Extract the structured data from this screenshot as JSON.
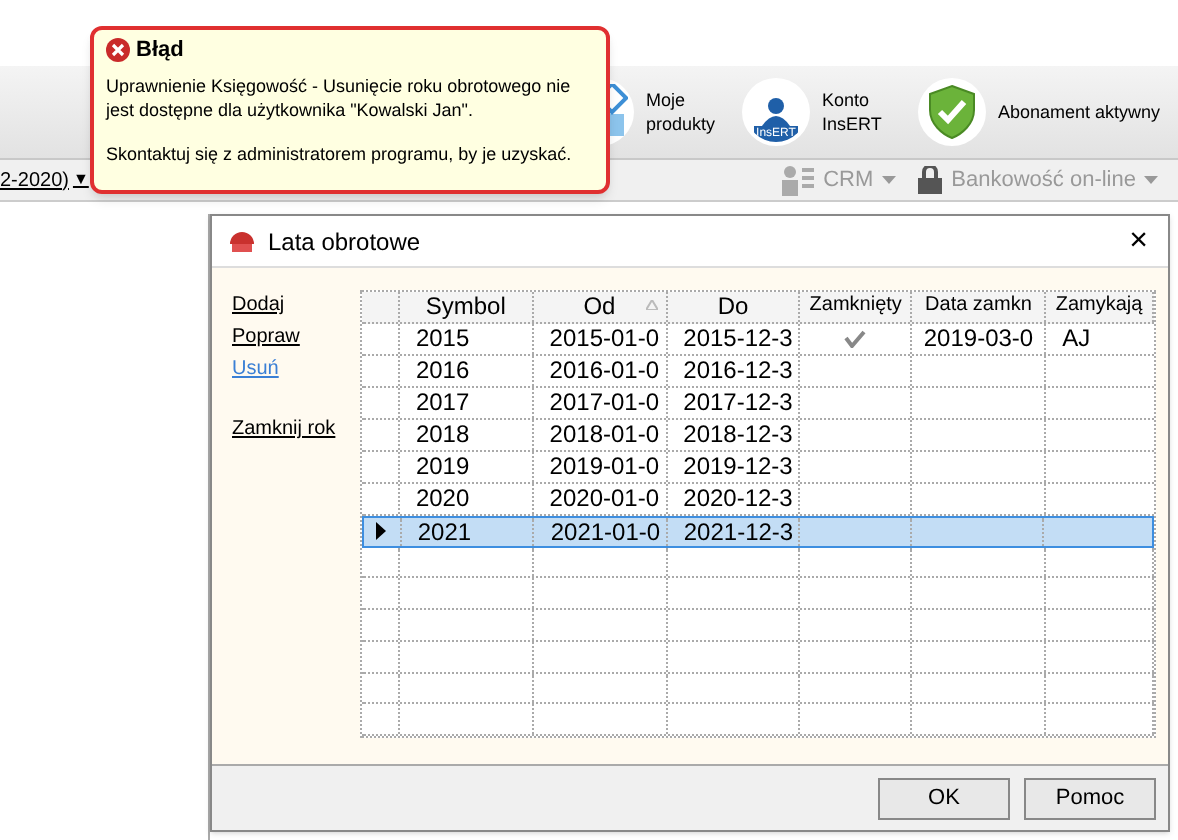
{
  "toolbar": {
    "items": [
      {
        "kind": "products",
        "label": "Moje produkty"
      },
      {
        "kind": "account",
        "label": "Konto InsERT",
        "icon_text": "InsERT"
      },
      {
        "kind": "shield",
        "label": "Abonament aktywny"
      }
    ]
  },
  "menu_bar": {
    "period": "2-2020)",
    "period_caret": "▼",
    "items": [
      {
        "kind": "crm",
        "label": "CRM",
        "disabled": true
      },
      {
        "kind": "bank",
        "label": "Bankowość on-line",
        "disabled": true
      }
    ]
  },
  "tooltip": {
    "title": "Błąd",
    "message": "Uprawnienie Księgowość - Usunięcie roku obrotowego nie jest dostępne dla użytkownika \"Kowalski Jan\".",
    "hint": "Skontaktuj się z administratorem programu, by je uzyskać."
  },
  "dialog": {
    "title": "Lata obrotowe",
    "close": "×",
    "actions": [
      {
        "label": "Dodaj",
        "highlighted": false
      },
      {
        "label": "Popraw",
        "highlighted": false
      },
      {
        "label": "Usuń",
        "highlighted": true
      },
      {
        "label": "Zamknij rok",
        "highlighted": false
      }
    ],
    "table": {
      "columns": [
        {
          "label": "Symbol",
          "sorted": false
        },
        {
          "label": "Od",
          "sorted": true
        },
        {
          "label": "Do",
          "sorted": false
        },
        {
          "label": "Zamknięty",
          "sorted": false
        },
        {
          "label": "Data zamkn",
          "sorted": false
        },
        {
          "label": "Zamykają",
          "sorted": false
        }
      ],
      "rows": [
        {
          "symbol": "2015",
          "from": "2015-01-0",
          "to": "2015-12-3",
          "closed": true,
          "closed_date": "2019-03-0",
          "closed_by": "AJ",
          "selected": false
        },
        {
          "symbol": "2016",
          "from": "2016-01-0",
          "to": "2016-12-3",
          "closed": false,
          "selected": false
        },
        {
          "symbol": "2017",
          "from": "2017-01-0",
          "to": "2017-12-3",
          "closed": false,
          "selected": false
        },
        {
          "symbol": "2018",
          "from": "2018-01-0",
          "to": "2018-12-3",
          "closed": false,
          "selected": false
        },
        {
          "symbol": "2019",
          "from": "2019-01-0",
          "to": "2019-12-3",
          "closed": false,
          "selected": false
        },
        {
          "symbol": "2020",
          "from": "2020-01-0",
          "to": "2020-12-3",
          "closed": false,
          "selected": false
        },
        {
          "symbol": "2021",
          "from": "2021-01-0",
          "to": "2021-12-3",
          "closed": false,
          "selected": true
        }
      ]
    },
    "buttons": [
      "OK",
      "Pomoc"
    ]
  }
}
